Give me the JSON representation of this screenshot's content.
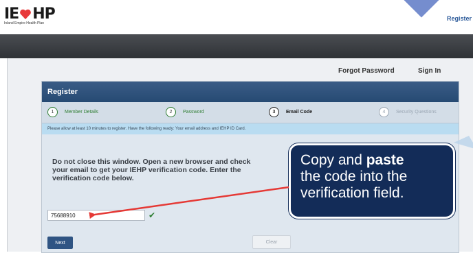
{
  "header": {
    "logo_text": "IEHP",
    "logo_subtitle": "Inland Empire Health Plan",
    "register_link": "Register"
  },
  "top_links": {
    "forgot_password": "Forgot Password",
    "sign_in": "Sign In"
  },
  "panel": {
    "title": "Register",
    "steps": [
      {
        "num": "1",
        "label": "Member Details",
        "state": "done"
      },
      {
        "num": "2",
        "label": "Password",
        "state": "done"
      },
      {
        "num": "3",
        "label": "Email Code",
        "state": "current"
      },
      {
        "num": "4",
        "label": "Security Questions",
        "state": "future"
      }
    ],
    "notice": "Please allow at least 10 minutes to register. Have the following ready: Your email address and IEHP ID Card.",
    "instructions": "Do not close this window. Open a new browser and check your email to get your IEHP verification code. Enter the verification code below.",
    "code_value": "75688910",
    "next_label": "Next",
    "clear_label": "Clear"
  },
  "callout": {
    "line1_pre": "Copy and ",
    "line1_bold": "paste",
    "line2": "the code into the",
    "line3": "verification field."
  },
  "colors": {
    "brand_red": "#e8393a",
    "panel_header": "#264a73",
    "callout_bg": "#132c58",
    "arrow": "#e53935",
    "success": "#2e7d32"
  }
}
